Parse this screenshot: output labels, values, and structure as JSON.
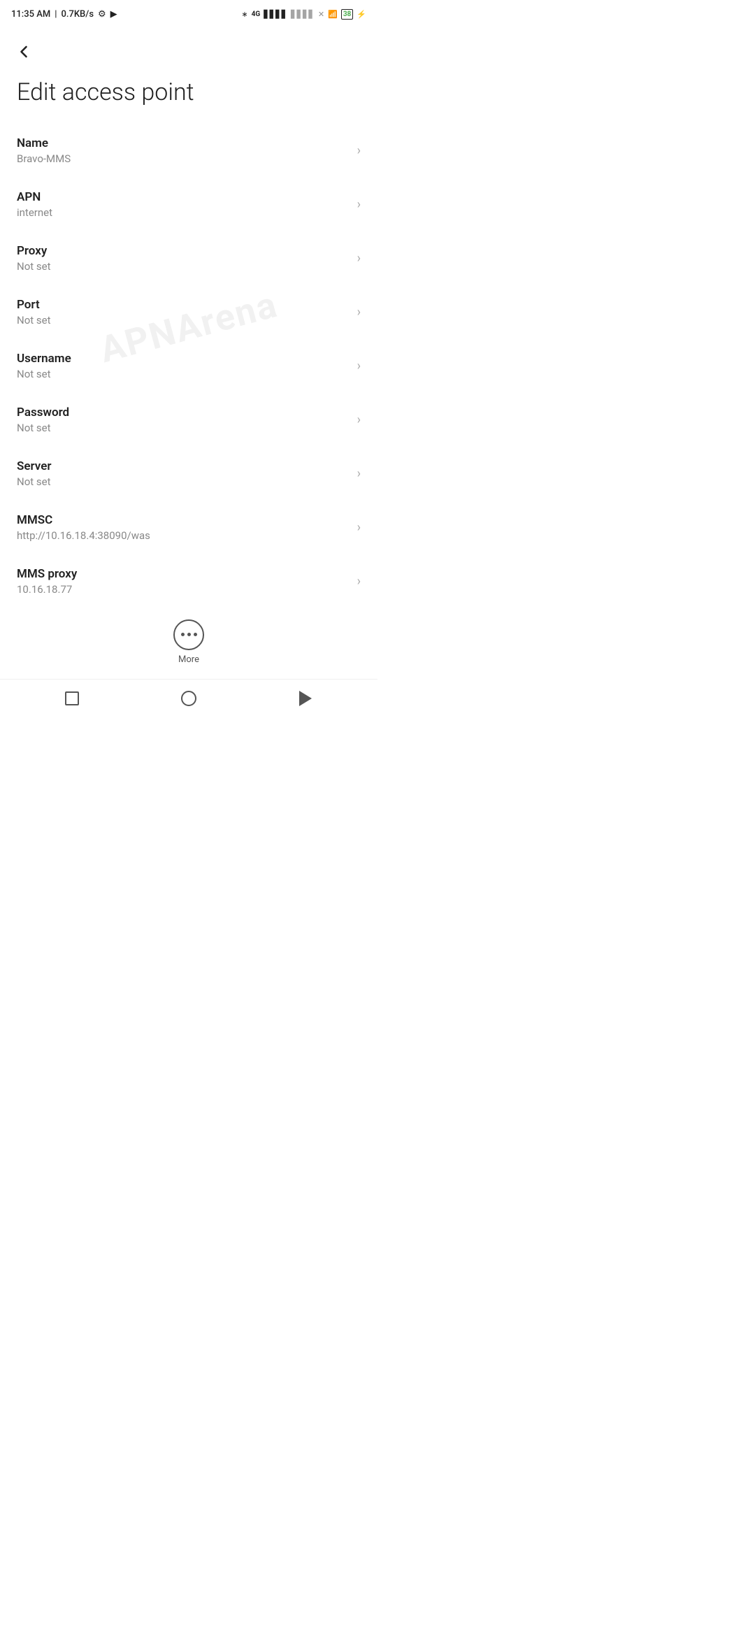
{
  "statusBar": {
    "time": "11:35 AM",
    "speed": "0.7KB/s"
  },
  "page": {
    "title": "Edit access point"
  },
  "settings": [
    {
      "label": "Name",
      "value": "Bravo-MMS"
    },
    {
      "label": "APN",
      "value": "internet"
    },
    {
      "label": "Proxy",
      "value": "Not set"
    },
    {
      "label": "Port",
      "value": "Not set"
    },
    {
      "label": "Username",
      "value": "Not set"
    },
    {
      "label": "Password",
      "value": "Not set"
    },
    {
      "label": "Server",
      "value": "Not set"
    },
    {
      "label": "MMSC",
      "value": "http://10.16.18.4:38090/was"
    },
    {
      "label": "MMS proxy",
      "value": "10.16.18.77"
    }
  ],
  "more": {
    "label": "More"
  },
  "watermark": "APNArena"
}
